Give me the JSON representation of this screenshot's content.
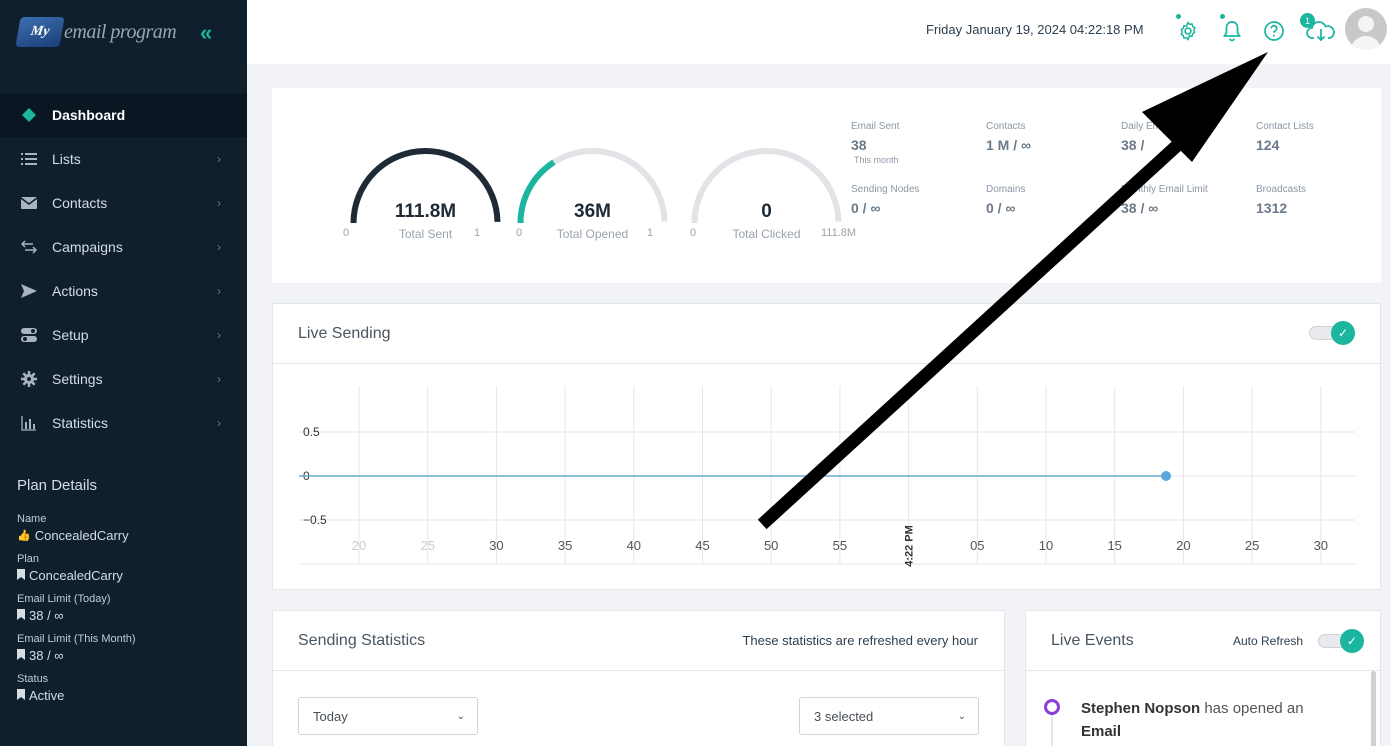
{
  "brand": {
    "logo_badge": "My",
    "logo_text": "email program"
  },
  "sidebar": {
    "items": [
      {
        "label": "Dashboard",
        "icon": "diamond-icon"
      },
      {
        "label": "Lists",
        "icon": "list-icon"
      },
      {
        "label": "Contacts",
        "icon": "envelope-icon"
      },
      {
        "label": "Campaigns",
        "icon": "arrows-icon"
      },
      {
        "label": "Actions",
        "icon": "paper-plane-icon"
      },
      {
        "label": "Setup",
        "icon": "toggle-icon"
      },
      {
        "label": "Settings",
        "icon": "gear-icon"
      },
      {
        "label": "Statistics",
        "icon": "bar-chart-icon"
      }
    ],
    "plan_title": "Plan Details",
    "plan": [
      {
        "label": "Name",
        "value": "ConcealedCarry",
        "icon": "thumbs-up-icon"
      },
      {
        "label": "Plan",
        "value": "ConcealedCarry",
        "icon": "bookmark-icon"
      },
      {
        "label": "Email Limit (Today)",
        "value": "38 / ∞",
        "icon": "bookmark-icon"
      },
      {
        "label": "Email Limit (This Month)",
        "value": "38 / ∞",
        "icon": "bookmark-icon"
      },
      {
        "label": "Status",
        "value": "Active",
        "icon": "bookmark-icon"
      }
    ]
  },
  "header": {
    "datetime": "Friday January 19, 2024 04:22:18 PM",
    "download_badge": "1"
  },
  "gauges": [
    {
      "value": "111.8M",
      "label": "Total Sent",
      "min": "0",
      "max": "1",
      "fraction": 1.0,
      "color": "#1e2a36"
    },
    {
      "value": "36M",
      "label": "Total Opened",
      "min": "0",
      "max": "1",
      "fraction": 0.32,
      "color": "#1bb5a0"
    },
    {
      "value": "0",
      "label": "Total Clicked",
      "min": "0",
      "max": "111.8M",
      "fraction": 0.0,
      "color": "#1bb5a0"
    }
  ],
  "stats": [
    {
      "label": "Email Sent",
      "value": "38",
      "sub": "This month"
    },
    {
      "label": "Contacts",
      "value": "1 M / ∞"
    },
    {
      "label": "Daily Em",
      "value": "38 /"
    },
    {
      "label": "Contact Lists",
      "value": "124"
    },
    {
      "label": "Sending Nodes",
      "value": "0 / ∞"
    },
    {
      "label": "Domains",
      "value": "0 / ∞"
    },
    {
      "label": "Monthly Email Limit",
      "value": "38 / ∞"
    },
    {
      "label": "Broadcasts",
      "value": "1312"
    }
  ],
  "live_sending": {
    "title": "Live Sending",
    "chart_data": {
      "type": "line",
      "x_ticks": [
        "20",
        "25",
        "30",
        "35",
        "40",
        "45",
        "50",
        "55",
        "4:22 PM",
        "05",
        "10",
        "15",
        "20",
        "25",
        "30"
      ],
      "y_ticks": [
        "0.5",
        "0",
        "−0.5"
      ],
      "ylim": [
        -0.5,
        0.5
      ],
      "series": [
        {
          "values": [
            0,
            0,
            0,
            0,
            0,
            0,
            0,
            0,
            0,
            0,
            0,
            0,
            0,
            0
          ]
        }
      ],
      "last_point_tick_index": 12,
      "line_color": "#6aa9cf"
    }
  },
  "sending_statistics": {
    "title": "Sending Statistics",
    "note": "These statistics are refreshed every hour",
    "period_select": "Today",
    "multi_select": "3 selected"
  },
  "live_events": {
    "title": "Live Events",
    "auto_refresh_label": "Auto Refresh",
    "event": {
      "name": "Stephen Nopson",
      "action": "has opened an",
      "object": "Email"
    }
  }
}
